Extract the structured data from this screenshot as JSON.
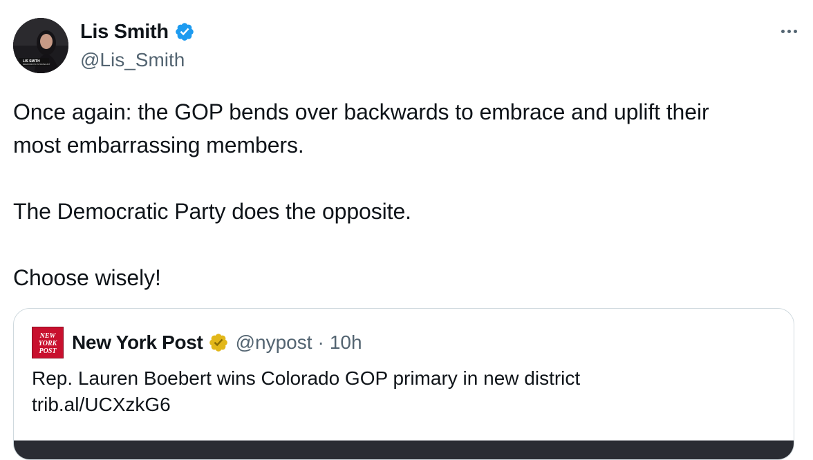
{
  "tweet": {
    "author": {
      "display_name": "Lis Smith",
      "handle": "@Lis_Smith",
      "verified_badge_color": "#1d9bf0",
      "avatar_icon": "profile-photo-icon"
    },
    "more_icon": "ellipsis-icon",
    "text_lines": [
      "Once again: the GOP bends over backwards to embrace and uplift their",
      "most embarrassing members.",
      "The Democratic Party does the opposite.",
      "Choose wisely!"
    ]
  },
  "quote": {
    "logo_icon": "new-york-post-logo-icon",
    "logo_text": "NEW YORK POST",
    "display_name": "New York Post",
    "verified_badge_color": "#e2b719",
    "handle": "@nypost",
    "separator": "·",
    "time": "10h",
    "text_line_1": "Rep. Lauren Boebert wins Colorado GOP primary in new district",
    "link": "trib.al/UCXzkG6",
    "brand_color": "#c8102e"
  }
}
